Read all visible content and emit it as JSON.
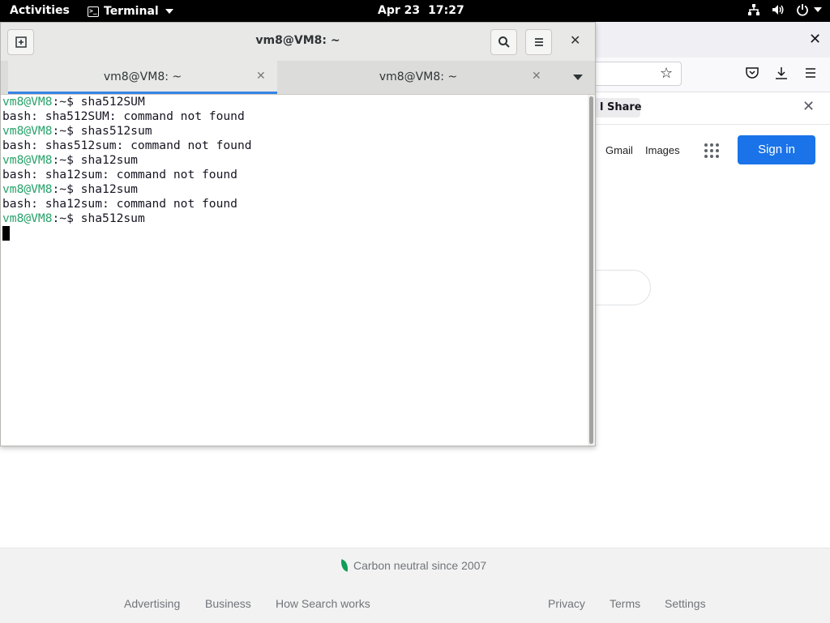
{
  "topbar": {
    "activities": "Activities",
    "app_name": "Terminal",
    "date": "Apr 23",
    "time": "17:27"
  },
  "browser": {
    "notification": {
      "share_label": "l Share"
    },
    "links": {
      "gmail": "Gmail",
      "images": "Images"
    },
    "signin_label": "Sign in",
    "footer": {
      "carbon": "Carbon neutral since 2007",
      "advertising": "Advertising",
      "business": "Business",
      "how_search_works": "How Search works",
      "privacy": "Privacy",
      "terms": "Terms",
      "settings": "Settings"
    },
    "colors": {
      "signin_bg": "#1a73e8",
      "leaf": "#0f9d58"
    }
  },
  "terminal": {
    "title": "vm8@VM8: ~",
    "tabs": [
      {
        "label": "vm8@VM8: ~",
        "active": true
      },
      {
        "label": "vm8@VM8: ~",
        "active": false
      }
    ],
    "prompt_user": "vm8@VM8",
    "prompt_suffix": ":~$ ",
    "lines": [
      {
        "kind": "prompt",
        "command": "sha512SUM"
      },
      {
        "kind": "output",
        "text": "bash: sha512SUM: command not found"
      },
      {
        "kind": "prompt",
        "command": "shas512sum"
      },
      {
        "kind": "output",
        "text": "bash: shas512sum: command not found"
      },
      {
        "kind": "prompt",
        "command": "sha12sum"
      },
      {
        "kind": "output",
        "text": "bash: sha12sum: command not found"
      },
      {
        "kind": "prompt",
        "command": "sha12sum"
      },
      {
        "kind": "output",
        "text": "bash: sha12sum: command not found"
      },
      {
        "kind": "prompt",
        "command": "sha512sum"
      }
    ],
    "colors": {
      "prompt": "#26a269",
      "tab_underline": "#3584e4"
    }
  }
}
